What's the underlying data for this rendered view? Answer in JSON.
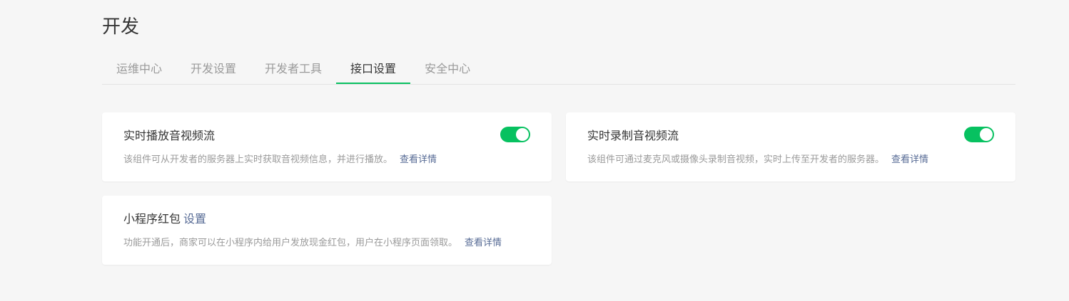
{
  "page": {
    "title": "开发"
  },
  "tabs": [
    {
      "label": "运维中心"
    },
    {
      "label": "开发设置"
    },
    {
      "label": "开发者工具"
    },
    {
      "label": "接口设置",
      "active": true
    },
    {
      "label": "安全中心"
    }
  ],
  "cards": [
    {
      "title": "实时播放音视频流",
      "description": "该组件可从开发者的服务器上实时获取音视频信息，并进行播放。",
      "link": "查看详情",
      "toggle_on": true
    },
    {
      "title": "实时录制音视频流",
      "description": "该组件可通过麦克风或摄像头录制音视频，实时上传至开发者的服务器。",
      "link": "查看详情",
      "toggle_on": true
    },
    {
      "title": "小程序红包",
      "title_link": "设置",
      "description": "功能开通后，商家可以在小程序内给用户发放现金红包，用户在小程序页面领取。",
      "link": "查看详情"
    }
  ],
  "colors": {
    "accent_green": "#07c160",
    "link_blue": "#576b95",
    "muted_text": "#9a9a9a",
    "background": "#f6f6f6"
  }
}
